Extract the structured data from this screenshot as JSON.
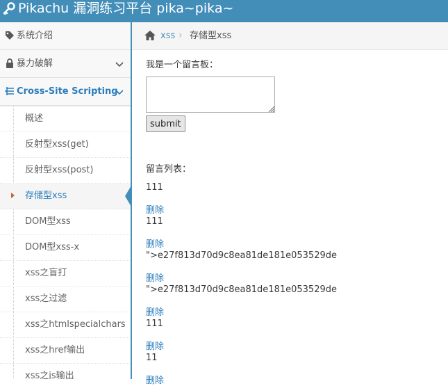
{
  "header": {
    "title": "Pikachu 漏洞练习平台 pika~pika~"
  },
  "sidebar": {
    "items": [
      {
        "label": "系统介绍",
        "icon": "tag-icon"
      },
      {
        "label": "暴力破解",
        "icon": "lock-icon"
      },
      {
        "label": "Cross-Site Scripting",
        "icon": "list-icon",
        "expanded": true
      }
    ],
    "sub_items": [
      {
        "label": "概述"
      },
      {
        "label": "反射型xss(get)"
      },
      {
        "label": "反射型xss(post)"
      },
      {
        "label": "存储型xss",
        "active": true
      },
      {
        "label": "DOM型xss"
      },
      {
        "label": "DOM型xss-x"
      },
      {
        "label": "xss之盲打"
      },
      {
        "label": "xss之过滤"
      },
      {
        "label": "xss之htmlspecialchars"
      },
      {
        "label": "xss之href输出"
      },
      {
        "label": "xss之js输出"
      }
    ]
  },
  "breadcrumb": {
    "link": "xss",
    "current": "存储型xss"
  },
  "main": {
    "board_label": "我是一个留言板：",
    "message_value": "",
    "submit_label": "submit",
    "list_label": "留言列表：",
    "delete_label": "删除",
    "messages": [
      {
        "text": "111"
      },
      {
        "text": "111"
      },
      {
        "text": "\">e27f813d70d9c8ea81de181e053529de"
      },
      {
        "text": "\">e27f813d70d9c8ea81de181e053529de"
      },
      {
        "text": "111"
      },
      {
        "text": "11"
      }
    ]
  },
  "colors": {
    "topbar": "#438eb9",
    "link": "#2b7dbc",
    "active_caret": "#c86139"
  }
}
